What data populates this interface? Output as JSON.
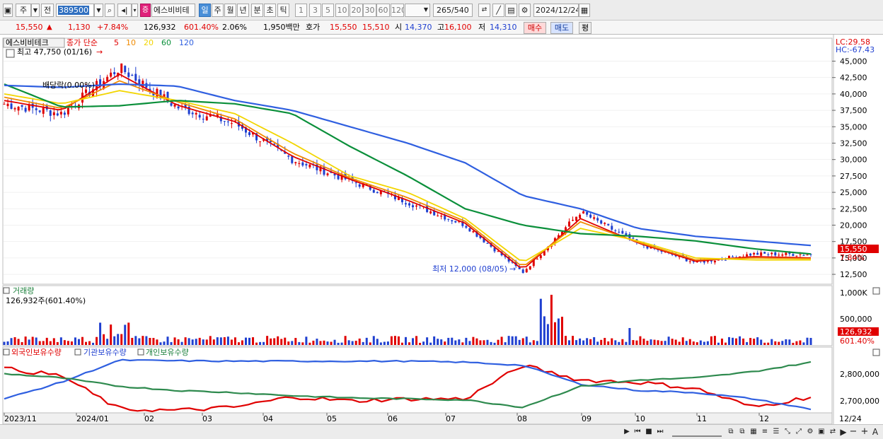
{
  "toolbar": {
    "period_main": "주",
    "prev_label": "전",
    "stock_code": "389500",
    "stock_name": "에스비비테",
    "badge": "증",
    "periods": [
      "일",
      "주",
      "월",
      "년",
      "분",
      "초",
      "틱"
    ],
    "ma_numbers": [
      "1",
      "3",
      "5",
      "10",
      "20",
      "30",
      "60",
      "120"
    ],
    "count": "265",
    "total": "/540",
    "date": "2024/12/24"
  },
  "info": {
    "price": "15,550",
    "change_arrow": "▲",
    "change": "1,130",
    "change_pct": "+7.84%",
    "volume": "126,932",
    "volume_ratio": "601.40%",
    "turnover": "2.06%",
    "amount": "1,950백만",
    "ask_label": "호가",
    "ask": "15,550",
    "bid": "15,510",
    "open_label": "시",
    "open": "14,370",
    "high_label": "고",
    "high": "16,100",
    "low_label": "저",
    "low": "14,310",
    "buy_label": "매수",
    "sell_label": "매도",
    "flat_label": "평"
  },
  "price_panel": {
    "stock_tag": "에스비비테크",
    "legend_title": "종가 단순",
    "legend_periods": [
      "5",
      "10",
      "20",
      "60",
      "120"
    ],
    "legend_colors": [
      "#e00000",
      "#f08a00",
      "#f2d500",
      "#0a8f3a",
      "#2f5fe0"
    ],
    "high_note": "최고 47,750 (01/16)",
    "low_note": "최저 12,000 (08/05)",
    "dividend_note": "배당락(0.00%)",
    "lc": "LC:29.58",
    "hc": "HC:-67.43",
    "current_tag": "15,550",
    "current_pct": "7.84%",
    "y_ticks": [
      "45,000",
      "42,500",
      "40,000",
      "37,500",
      "35,000",
      "32,500",
      "30,000",
      "27,500",
      "25,000",
      "22,500",
      "20,000",
      "17,500",
      "15,000",
      "12,500"
    ]
  },
  "volume_panel": {
    "title": "거래량",
    "value_note": "126,932주(601.40%)",
    "y_ticks": [
      "1,000K",
      "500,000"
    ],
    "current_tag": "126,932",
    "current_pct": "601.40%"
  },
  "holdings_panel": {
    "legend": [
      "외국인보유수량",
      "기관보유수량",
      "개인보유수량"
    ],
    "y_ticks": [
      "2,800,000",
      "2,700,000"
    ]
  },
  "x_axis": {
    "labels": [
      "2023/11",
      "2024/01",
      "02",
      "03",
      "04",
      "05",
      "06",
      "07",
      "08",
      "09",
      "10",
      "11",
      "12",
      "12/24"
    ]
  },
  "chart_data": [
    {
      "type": "line",
      "title": "에스비비테크",
      "x": [
        "2023/11",
        "2023/12",
        "2024/01",
        "2024/02",
        "2024/03",
        "2024/04",
        "2024/05",
        "2024/06",
        "2024/07",
        "2024/08",
        "2024/09",
        "2024/10",
        "2024/11",
        "2024/12",
        "2024/12/24"
      ],
      "series": [
        {
          "name": "종가",
          "values": [
            38500,
            37000,
            44000,
            38000,
            35500,
            30000,
            26800,
            23500,
            20000,
            12800,
            22000,
            17200,
            14300,
            15600,
            15550
          ]
        },
        {
          "name": "5",
          "values": [
            39000,
            37500,
            43000,
            38300,
            35800,
            30500,
            27000,
            23800,
            20300,
            13200,
            21000,
            17300,
            14500,
            15200,
            15000
          ]
        },
        {
          "name": "10",
          "values": [
            39500,
            37800,
            42000,
            38800,
            36200,
            31000,
            27200,
            24200,
            20600,
            13600,
            20500,
            17400,
            14700,
            15000,
            14900
          ]
        },
        {
          "name": "20",
          "values": [
            40000,
            38500,
            40500,
            39000,
            37000,
            32500,
            27500,
            25000,
            21000,
            14300,
            19500,
            17600,
            15000,
            14700,
            14700
          ]
        },
        {
          "name": "60",
          "values": [
            41500,
            38000,
            38200,
            39000,
            38500,
            37000,
            32000,
            27500,
            22500,
            20000,
            18700,
            18300,
            17600,
            16400,
            15600
          ]
        },
        {
          "name": "120",
          "values": [
            41300,
            41000,
            41500,
            41200,
            39000,
            37500,
            35000,
            32500,
            29500,
            24500,
            22500,
            19500,
            18300,
            17600,
            16900
          ]
        }
      ],
      "high": 47750,
      "high_date": "01/16",
      "low": 12000,
      "low_date": "08/05",
      "ylim": [
        11000,
        48500
      ]
    },
    {
      "type": "bar",
      "title": "거래량",
      "y_ticks": [
        "1,000K",
        "500,000"
      ],
      "last": 126932
    },
    {
      "type": "line",
      "title": "보유수량",
      "series": [
        {
          "name": "외국인보유수량",
          "values": [
            2845000,
            2810000,
            2650000,
            2645000,
            2660000,
            2710000,
            2690000,
            2700000,
            2700000,
            2860000,
            2790000,
            2780000,
            2750000,
            2660000,
            2710000
          ]
        },
        {
          "name": "기관보유수량",
          "values": [
            2700000,
            2780000,
            2885000,
            2882000,
            2880000,
            2880000,
            2880000,
            2880000,
            2875000,
            2860000,
            2770000,
            2740000,
            2730000,
            2700000,
            2650000
          ]
        },
        {
          "name": "개인보유수량",
          "values": [
            2820000,
            2800000,
            2760000,
            2740000,
            2730000,
            2715000,
            2705000,
            2700000,
            2695000,
            2660000,
            2760000,
            2790000,
            2800000,
            2830000,
            2875000
          ]
        }
      ],
      "ylim": [
        2640000,
        2900000
      ]
    }
  ]
}
